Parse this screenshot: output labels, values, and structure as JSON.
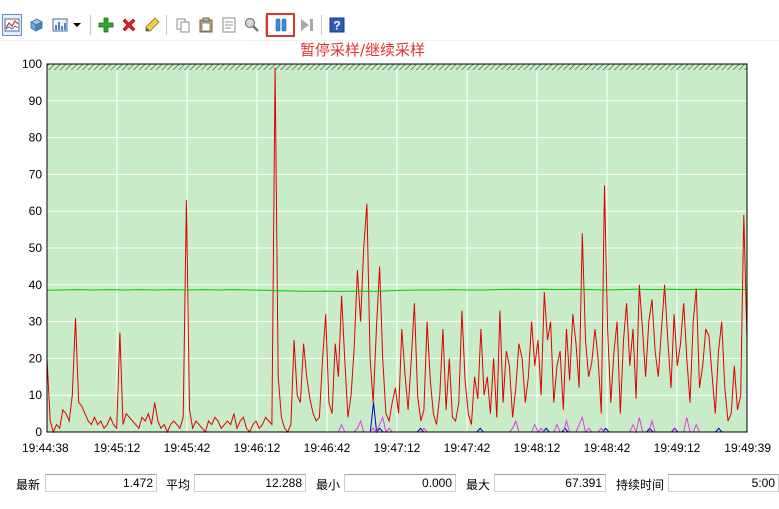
{
  "toolbar": {
    "buttons": [
      {
        "icon": "graph-view-icon",
        "active": true
      },
      {
        "icon": "clear-display-icon"
      },
      {
        "icon": "change-graph-type-icon"
      },
      {
        "icon": "dropdown-arrow-icon"
      },
      {
        "icon": "add-counter-icon"
      },
      {
        "icon": "delete-counter-icon"
      },
      {
        "icon": "highlight-icon"
      },
      {
        "icon": "copy-properties-icon"
      },
      {
        "icon": "paste-counter-list-icon"
      },
      {
        "icon": "properties-icon"
      },
      {
        "icon": "zoom-icon"
      },
      {
        "icon": "pause-icon",
        "highlighted": true
      },
      {
        "icon": "update-data-icon"
      },
      {
        "icon": "help-icon"
      }
    ]
  },
  "annotation": {
    "text": "暂停采样/继续采样",
    "color": "#e53030"
  },
  "chart_data": {
    "type": "line",
    "plot_background": "#c8ecc8",
    "ylim": [
      0,
      100
    ],
    "y_ticks": [
      "0",
      "10",
      "20",
      "30",
      "40",
      "50",
      "60",
      "70",
      "80",
      "90",
      "100"
    ],
    "x_tick_labels": [
      "19:44:38",
      "19:45:12",
      "19:45:42",
      "19:46:12",
      "19:46:42",
      "19:47:12",
      "19:47:42",
      "19:48:12",
      "19:48:42",
      "19:49:12",
      "19:49:39"
    ],
    "series": [
      {
        "color": "#e00000",
        "values": [
          20,
          3,
          0,
          2,
          1,
          6,
          5,
          3,
          10,
          31,
          8,
          7,
          5,
          3,
          2,
          4,
          2,
          3,
          1,
          2,
          4,
          2,
          1,
          27,
          2,
          5,
          4,
          3,
          2,
          1,
          4,
          3,
          5,
          2,
          8,
          3,
          1,
          2,
          0,
          2,
          3,
          2,
          1,
          4,
          63,
          6,
          1,
          3,
          2,
          1,
          0,
          3,
          2,
          4,
          3,
          1,
          2,
          3,
          2,
          5,
          1,
          3,
          4,
          1,
          0,
          2,
          3,
          1,
          2,
          4,
          3,
          2,
          99,
          15,
          4,
          1,
          0,
          2,
          25,
          10,
          8,
          24,
          15,
          9,
          5,
          3,
          4,
          20,
          32,
          8,
          5,
          24,
          15,
          37,
          20,
          4,
          10,
          23,
          44,
          30,
          50,
          62,
          20,
          8,
          28,
          45,
          20,
          5,
          3,
          8,
          12,
          5,
          28,
          16,
          6,
          20,
          35,
          10,
          3,
          6,
          30,
          14,
          5,
          2,
          10,
          28,
          6,
          20,
          4,
          3,
          8,
          33,
          14,
          5,
          2,
          15,
          9,
          28,
          10,
          15,
          5,
          20,
          4,
          33,
          8,
          22,
          18,
          4,
          12,
          24,
          20,
          8,
          15,
          30,
          18,
          25,
          10,
          38,
          25,
          30,
          8,
          18,
          22,
          6,
          28,
          14,
          32,
          24,
          12,
          54,
          25,
          15,
          19,
          28,
          20,
          5,
          67,
          28,
          8,
          22,
          30,
          5,
          25,
          35,
          18,
          28,
          9,
          40,
          28,
          15,
          30,
          36,
          22,
          15,
          28,
          40,
          25,
          12,
          32,
          18,
          24,
          35,
          20,
          8,
          30,
          39,
          12,
          18,
          28,
          26,
          15,
          5,
          22,
          30,
          12,
          3,
          5,
          18,
          6,
          10,
          59,
          25
        ]
      },
      {
        "color": "#00cc00",
        "values": [
          38.5,
          38.6,
          38.7,
          38.6,
          38.7,
          38.6,
          38.7,
          38.6,
          38.7,
          38.6,
          38.7,
          38.6,
          38.7,
          38.6,
          38.5,
          38.4,
          38.3,
          38.2,
          38.3,
          38.2,
          38.3,
          38.2,
          38.4,
          38.5,
          38.6,
          38.6,
          38.7,
          38.6,
          38.6,
          38.7,
          38.8,
          38.7,
          38.8,
          38.7,
          38.8,
          38.7,
          38.6,
          38.7,
          38.8,
          38.7,
          38.8,
          38.7,
          38.8,
          38.7,
          38.8,
          38.7
        ]
      },
      {
        "color": "#0000c8",
        "values": [
          0,
          0,
          0,
          0,
          0,
          0,
          0,
          0,
          0,
          0,
          0,
          0,
          0,
          0,
          0,
          0,
          0,
          0,
          0,
          0,
          0,
          0,
          0,
          0,
          0,
          0,
          0,
          0,
          0,
          0,
          0,
          0,
          0,
          0,
          0,
          0,
          0,
          0,
          0,
          0,
          0,
          0,
          0,
          0,
          0,
          0,
          0,
          0,
          0,
          0,
          0,
          0,
          0,
          0,
          0,
          0,
          0,
          0,
          0,
          0,
          0,
          0,
          0,
          0,
          0,
          0,
          0,
          0,
          0,
          0,
          0,
          0,
          0,
          0,
          0,
          0,
          0,
          0,
          0,
          0,
          0,
          0,
          0,
          0,
          0,
          0,
          0,
          0,
          0,
          0,
          0,
          0,
          0,
          0,
          0,
          0,
          0,
          0,
          0,
          0,
          0,
          0,
          0,
          0,
          8,
          0,
          1,
          0,
          0,
          0,
          0,
          0,
          0,
          0,
          0,
          0,
          0,
          0,
          0,
          1,
          0,
          0,
          0,
          0,
          0,
          0,
          0,
          0,
          0,
          0,
          0,
          0,
          0,
          0,
          0,
          0,
          0,
          0,
          1,
          0,
          0,
          0,
          0,
          0,
          0,
          0,
          0,
          0,
          0,
          0,
          0,
          0,
          0,
          0,
          0,
          0,
          0,
          0,
          0,
          1,
          0,
          0,
          0,
          0,
          0,
          1,
          0,
          0,
          0,
          0,
          0,
          0,
          0,
          0,
          0,
          0,
          0,
          0,
          1,
          0,
          0,
          0,
          0,
          0,
          0,
          0,
          0,
          0,
          0,
          0,
          0,
          0,
          1,
          0,
          0,
          0,
          0,
          0,
          0,
          0,
          1,
          0,
          0,
          0,
          0,
          0,
          0,
          0,
          0,
          0,
          0,
          0,
          0,
          0,
          1,
          0,
          0,
          0,
          0,
          0,
          0,
          0,
          0,
          0
        ]
      },
      {
        "color": "#e040e0",
        "values": [
          0,
          0,
          0,
          0,
          0,
          0,
          0,
          0,
          0,
          0,
          0,
          0,
          0,
          0,
          0,
          0,
          0,
          0,
          0,
          0,
          0,
          0,
          0,
          0,
          0,
          0,
          0,
          0,
          0,
          0,
          0,
          0,
          0,
          0,
          0,
          0,
          0,
          0,
          0,
          0,
          0,
          0,
          0,
          0,
          0,
          0,
          0,
          0,
          0,
          0,
          0,
          0,
          0,
          0,
          0,
          0,
          0,
          0,
          0,
          0,
          0,
          0,
          0,
          0,
          0,
          0,
          0,
          0,
          0,
          0,
          0,
          0,
          0,
          0,
          0,
          0,
          0,
          0,
          0,
          0,
          0,
          0,
          0,
          0,
          0,
          0,
          0,
          0,
          0,
          0,
          0,
          0,
          0,
          2,
          0,
          0,
          0,
          0,
          1,
          3,
          0,
          0,
          0,
          1,
          0,
          2,
          4,
          0,
          1,
          0,
          0,
          0,
          0,
          0,
          0,
          0,
          0,
          0,
          0,
          1,
          0,
          0,
          0,
          0,
          0,
          0,
          0,
          0,
          0,
          0,
          0,
          0,
          0,
          0,
          0,
          0,
          0,
          0,
          0,
          0,
          0,
          0,
          0,
          0,
          0,
          0,
          0,
          1,
          3,
          0,
          0,
          0,
          0,
          0,
          2,
          0,
          1,
          0,
          0,
          0,
          0,
          2,
          0,
          0,
          3,
          0,
          0,
          0,
          2,
          4,
          0,
          1,
          0,
          0,
          0,
          1,
          0,
          0,
          0,
          0,
          0,
          0,
          0,
          0,
          0,
          2,
          0,
          4,
          0,
          0,
          0,
          3,
          0,
          0,
          0,
          0,
          0,
          0,
          1,
          0,
          0,
          0,
          4,
          0,
          0,
          2,
          0,
          0,
          0,
          0,
          0,
          0,
          0,
          0,
          0,
          0,
          0,
          0,
          0,
          0,
          0,
          0
        ]
      }
    ]
  },
  "stats": [
    {
      "label": "最新",
      "value": "1.472"
    },
    {
      "label": "平均",
      "value": "12.288"
    },
    {
      "label": "最小",
      "value": "0.000"
    },
    {
      "label": "最大",
      "value": "67.391"
    },
    {
      "label": "持续时间",
      "value": "5:00"
    }
  ]
}
